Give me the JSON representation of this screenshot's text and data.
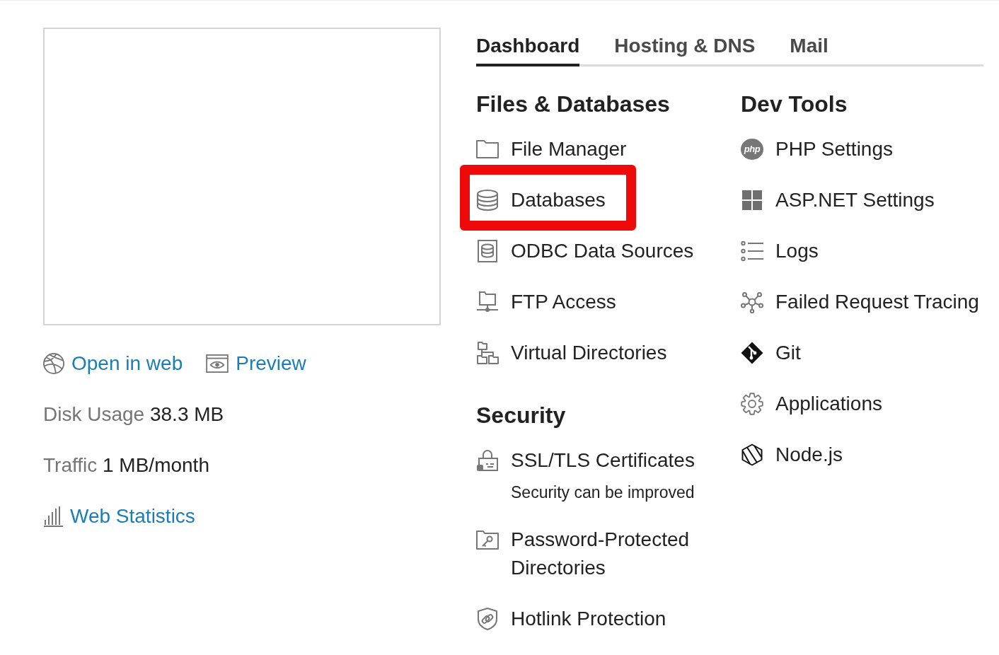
{
  "site_card": {
    "links": [
      {
        "label": "Open in web"
      },
      {
        "label": "Preview"
      }
    ],
    "stats": [
      {
        "label": "Disk Usage",
        "value": "38.3 MB"
      },
      {
        "label": "Traffic",
        "value": "1 MB/month"
      }
    ],
    "statistics_link": {
      "label": "Web Statistics"
    }
  },
  "tabs": [
    {
      "label": "Dashboard",
      "selected": true
    },
    {
      "label": "Hosting & DNS",
      "selected": false
    },
    {
      "label": "Mail",
      "selected": false
    }
  ],
  "columns": [
    {
      "sections": [
        {
          "title": "Files & Databases",
          "items": [
            {
              "label": "File Manager",
              "highlighted": false
            },
            {
              "label": "Databases",
              "highlighted": true
            },
            {
              "label": "ODBC Data Sources",
              "highlighted": false
            },
            {
              "label": "FTP Access",
              "highlighted": false
            },
            {
              "label": "Virtual Directories",
              "highlighted": false
            }
          ]
        },
        {
          "title": "Security",
          "items": [
            {
              "label": "SSL/TLS Certificates",
              "note": "Security can be improved",
              "highlighted": false
            },
            {
              "label": "Password-Protected Directories",
              "highlighted": false
            },
            {
              "label": "Hotlink Protection",
              "highlighted": false
            }
          ]
        }
      ]
    },
    {
      "sections": [
        {
          "title": "Dev Tools",
          "items": [
            {
              "label": "PHP Settings",
              "badge": "php",
              "highlighted": false
            },
            {
              "label": "ASP.NET Settings",
              "highlighted": false
            },
            {
              "label": "Logs",
              "highlighted": false
            },
            {
              "label": "Failed Request Tracing",
              "highlighted": false
            },
            {
              "label": "Git",
              "highlighted": false
            },
            {
              "label": "Applications",
              "highlighted": false
            },
            {
              "label": "Node.js",
              "highlighted": false
            }
          ]
        }
      ]
    }
  ]
}
